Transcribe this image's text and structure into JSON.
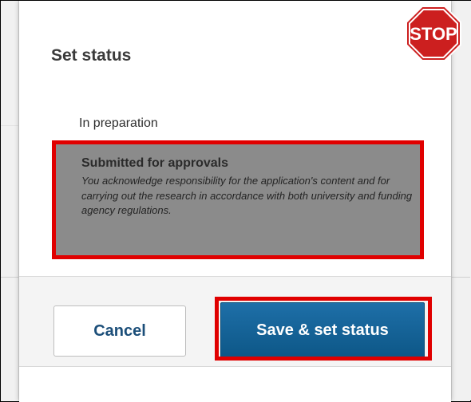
{
  "dialog": {
    "title": "Set status",
    "stop_sign_text": "STOP"
  },
  "status_options": [
    {
      "label": "In preparation",
      "description": ""
    },
    {
      "label": "Submitted for approvals",
      "description": "You acknowledge responsibility for the application's content and for carrying out the research in accordance with both university and funding agency regulations."
    }
  ],
  "buttons": {
    "cancel_label": "Cancel",
    "save_label": "Save & set status"
  },
  "colors": {
    "highlight": "#e00000",
    "selected_option_bg": "#8b8b8b",
    "primary_button": "#0d5787",
    "cancel_text": "#1b4e79"
  },
  "icons": {
    "stop": "stop-sign-icon"
  }
}
